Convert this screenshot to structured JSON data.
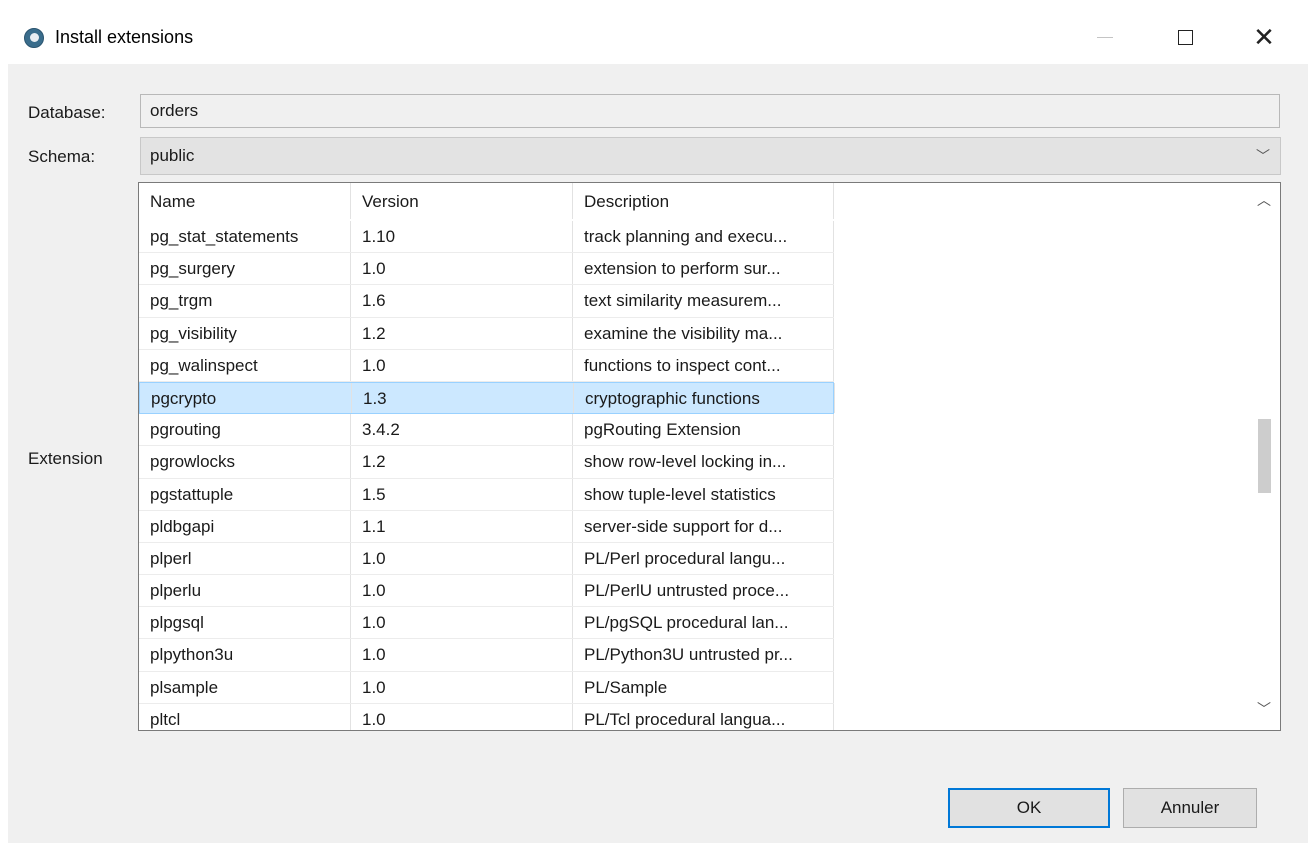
{
  "window": {
    "title": "Install extensions"
  },
  "form": {
    "database_label": "Database:",
    "database_value": "orders",
    "schema_label": "Schema:",
    "schema_value": "public",
    "extension_label": "Extension"
  },
  "table": {
    "columns": [
      "Name",
      "Version",
      "Description"
    ],
    "rows": [
      {
        "name": "pg_stat_statements",
        "version": "1.10",
        "description": "track planning and execu..."
      },
      {
        "name": "pg_surgery",
        "version": "1.0",
        "description": "extension to perform sur..."
      },
      {
        "name": "pg_trgm",
        "version": "1.6",
        "description": "text similarity measurem..."
      },
      {
        "name": "pg_visibility",
        "version": "1.2",
        "description": "examine the visibility ma..."
      },
      {
        "name": "pg_walinspect",
        "version": "1.0",
        "description": "functions to inspect cont..."
      },
      {
        "name": "pgcrypto",
        "version": "1.3",
        "description": "cryptographic functions",
        "selected": true
      },
      {
        "name": "pgrouting",
        "version": "3.4.2",
        "description": "pgRouting Extension"
      },
      {
        "name": "pgrowlocks",
        "version": "1.2",
        "description": "show row-level locking in..."
      },
      {
        "name": "pgstattuple",
        "version": "1.5",
        "description": "show tuple-level statistics"
      },
      {
        "name": "pldbgapi",
        "version": "1.1",
        "description": "server-side support for d..."
      },
      {
        "name": "plperl",
        "version": "1.0",
        "description": "PL/Perl procedural langu..."
      },
      {
        "name": "plperlu",
        "version": "1.0",
        "description": "PL/PerlU untrusted proce..."
      },
      {
        "name": "plpgsql",
        "version": "1.0",
        "description": "PL/pgSQL procedural lan..."
      },
      {
        "name": "plpython3u",
        "version": "1.0",
        "description": "PL/Python3U untrusted pr..."
      },
      {
        "name": "plsample",
        "version": "1.0",
        "description": "PL/Sample"
      },
      {
        "name": "pltcl",
        "version": "1.0",
        "description": "PL/Tcl procedural langua..."
      }
    ]
  },
  "buttons": {
    "ok": "OK",
    "cancel": "Annuler"
  },
  "icons": {
    "app": "app-logo-icon",
    "minimize": "minimize-icon",
    "maximize": "maximize-icon",
    "close": "close-icon",
    "dropdown": "chevron-down-icon",
    "scroll_up": "chevron-up-icon",
    "scroll_down": "chevron-down-icon"
  },
  "colors": {
    "selection": "#cce8ff",
    "ok_border": "#0078d7"
  }
}
